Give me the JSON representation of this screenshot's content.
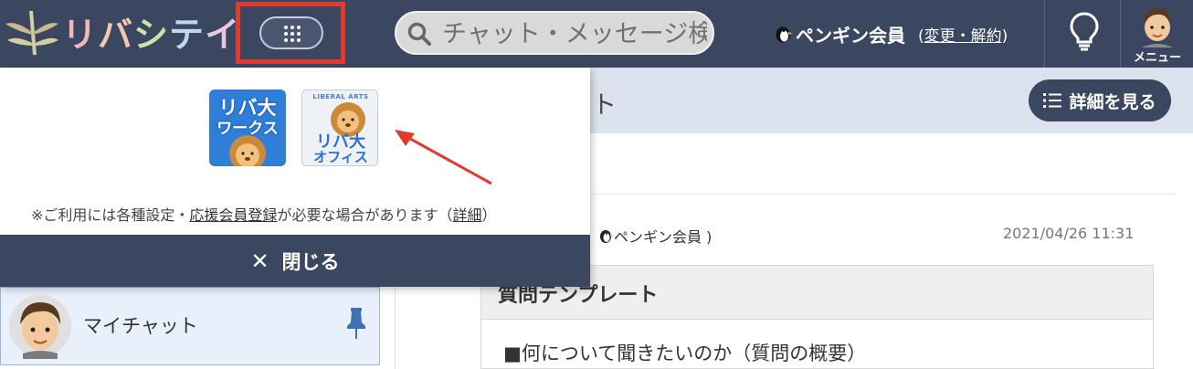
{
  "header": {
    "logo_text": "リバシティ",
    "search_placeholder": "チャット・メッセージ検索",
    "user_name": "ペンギン会員",
    "change_link": "変更・解約",
    "menu_label": "メニュー"
  },
  "dropdown": {
    "apps": [
      {
        "name": "リバ大 ワークス",
        "line1": "リバ大",
        "line2": "ワークス"
      },
      {
        "name": "リバ大 オフィス",
        "badge": "LIBERAL ARTS",
        "line1": "リバ大",
        "line2": "オフィス"
      }
    ],
    "note_prefix": "※ご利用には各種設定・",
    "note_link": "応援会員登録",
    "note_middle": "が必要な場合があります（",
    "note_detail": "詳細",
    "note_suffix": "）",
    "close_label": "閉じる"
  },
  "chat": {
    "title_tail": "ト",
    "detail_button": "詳細を見る",
    "message_author": "ペンギン会員 )",
    "message_time": "2021/04/26 11:31",
    "template_title": "質問テンプレート",
    "template_line": "■何について聞きたいのか（質問の概要）"
  },
  "sidebar": {
    "mychat_label": "マイチャット"
  },
  "colors": {
    "header_bg": "#3b4660",
    "highlight": "#e23b2e",
    "arrow": "#e23b2e"
  }
}
